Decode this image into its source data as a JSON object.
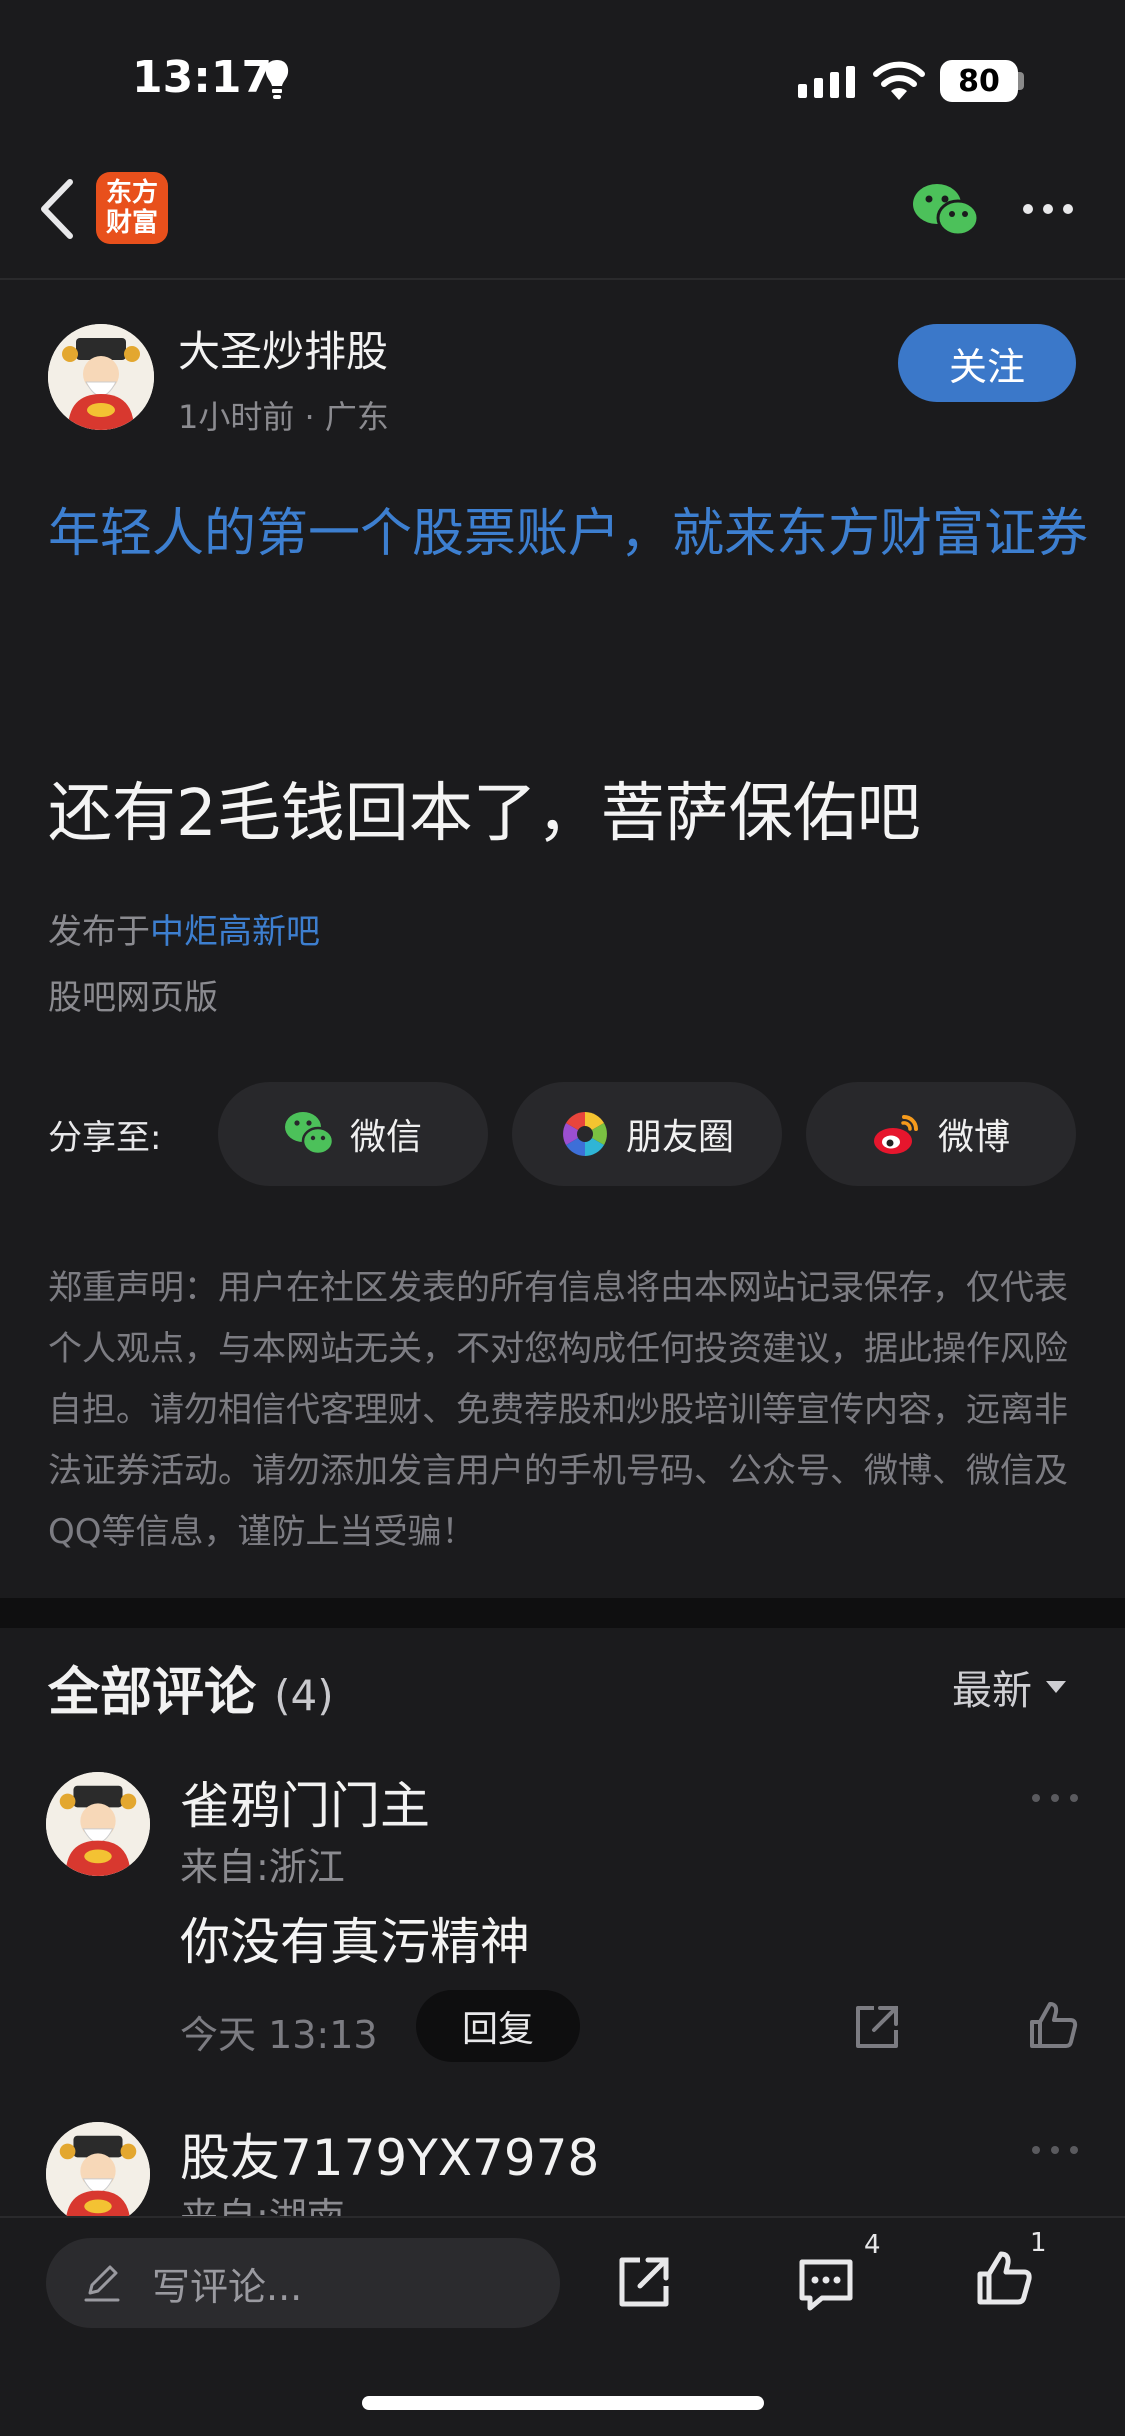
{
  "status_bar": {
    "time": "13:17",
    "battery": "80"
  },
  "nav": {
    "logo_text": "东方\n财富"
  },
  "author": {
    "name": "大圣炒排股",
    "meta": "1小时前 · 广东",
    "follow_label": "关注"
  },
  "post": {
    "promo": "年轻人的第一个股票账户，就来东方财富证券",
    "title": "还有2毛钱回本了，菩萨保佑吧",
    "published_prefix": "发布于",
    "forum": "中炬高新吧",
    "web_version": "股吧网页版"
  },
  "share": {
    "label": "分享至:",
    "buttons": [
      {
        "label": "微信",
        "icon": "wechat-icon"
      },
      {
        "label": "朋友圈",
        "icon": "moments-icon"
      },
      {
        "label": "微博",
        "icon": "weibo-icon"
      }
    ]
  },
  "disclaimer": "郑重声明：用户在社区发表的所有信息将由本网站记录保存，仅代表个人观点，与本网站无关，不对您构成任何投资建议，据此操作风险自担。请勿相信代客理财、免费荐股和炒股培训等宣传内容，远离非法证券活动。请勿添加发言用户的手机号码、公众号、微博、微信及QQ等信息，谨防上当受骗！",
  "comments": {
    "title": "全部评论",
    "count": "(4)",
    "sort_label": "最新",
    "items": [
      {
        "name": "雀鸦门门主",
        "location": "来自:浙江",
        "text": "你没有真污精神",
        "time": "今天 13:13",
        "reply_label": "回复"
      },
      {
        "name": "股友7179YX7978",
        "location": "来自:湖南"
      }
    ]
  },
  "bottom_bar": {
    "input_placeholder": "写评论...",
    "comment_count": "4",
    "like_count": "1"
  },
  "colors": {
    "background": "#1b1b1d",
    "accent_blue": "#3d7fd0",
    "follow_button": "#3b78c9",
    "logo_orange": "#e8501c"
  }
}
